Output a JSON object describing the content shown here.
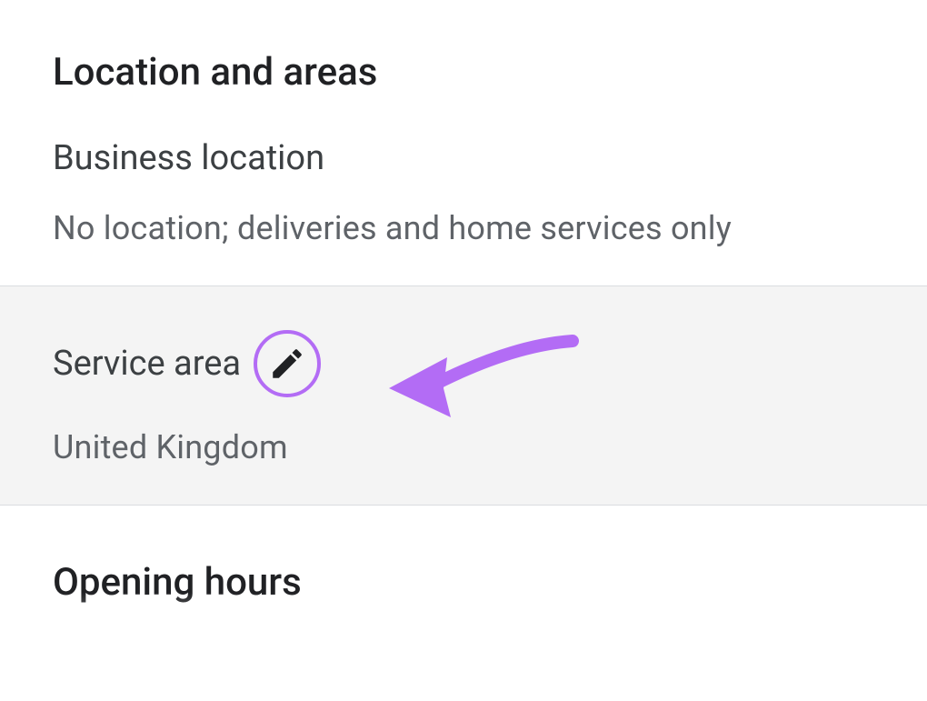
{
  "page": {
    "title": "Location and areas"
  },
  "businessLocation": {
    "heading": "Business location",
    "value": "No location; deliveries and home services only"
  },
  "serviceArea": {
    "heading": "Service area",
    "value": "United Kingdom"
  },
  "openingHours": {
    "heading": "Opening hours"
  },
  "annotation": {
    "color": "#b36cf5"
  }
}
